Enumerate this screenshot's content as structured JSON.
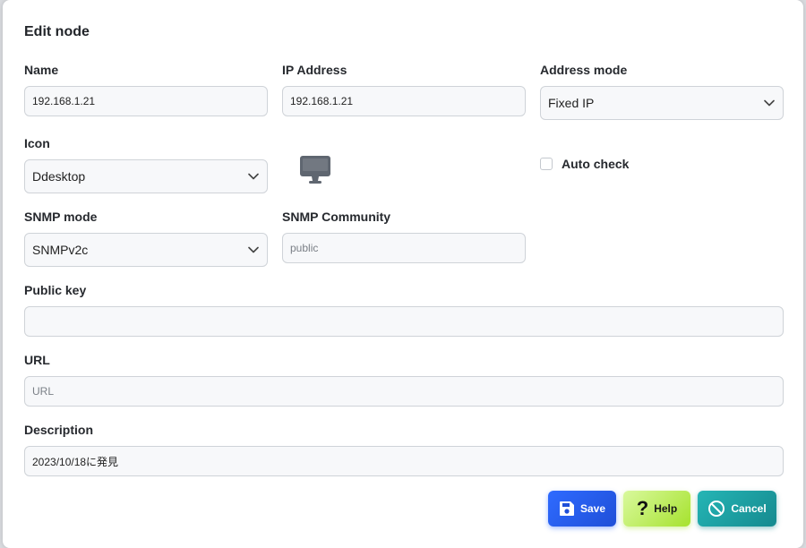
{
  "dialog": {
    "title": "Edit node"
  },
  "fields": {
    "name": {
      "label": "Name",
      "value": "192.168.1.21"
    },
    "ip_address": {
      "label": "IP Address",
      "value": "192.168.1.21"
    },
    "address_mode": {
      "label": "Address mode",
      "value": "Fixed IP"
    },
    "icon": {
      "label": "Icon",
      "value": "Ddesktop",
      "preview_icon": "desktop-monitor-icon"
    },
    "auto_check": {
      "label": "Auto check",
      "checked": false
    },
    "snmp_mode": {
      "label": "SNMP mode",
      "value": "SNMPv2c"
    },
    "snmp_community": {
      "label": "SNMP Community",
      "value": "",
      "placeholder": "public"
    },
    "public_key": {
      "label": "Public key",
      "value": ""
    },
    "url": {
      "label": "URL",
      "value": "",
      "placeholder": "URL"
    },
    "description": {
      "label": "Description",
      "value": "2023/10/18に発見"
    }
  },
  "buttons": {
    "save": {
      "label": "Save",
      "icon": "floppy-disk-icon",
      "color": "#2f6bff"
    },
    "help": {
      "label": "Help",
      "icon": "question-mark-icon",
      "color": "#a6e22e"
    },
    "cancel": {
      "label": "Cancel",
      "icon": "ban-icon",
      "color": "#158a8f"
    }
  }
}
